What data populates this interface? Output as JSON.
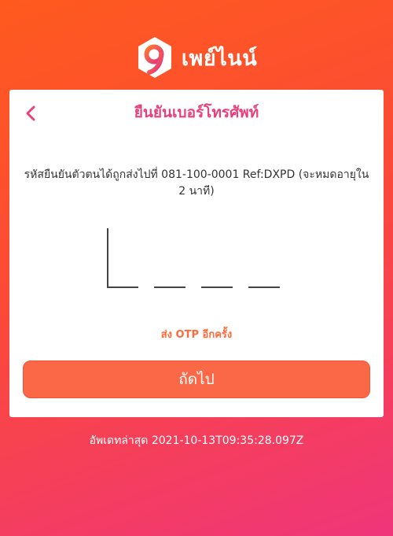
{
  "app": {
    "brand_name": "เพย์ไนน์",
    "logo_icon": "nine-hexagon-logo-icon"
  },
  "colors": {
    "gradient_top": "#ff5a1e",
    "gradient_bottom": "#f0357a",
    "accent_pink": "#e8407c",
    "accent_orange": "#fb6847"
  },
  "card": {
    "back_icon": "chevron-left-icon",
    "title": "ยืนยันเบอร์โทรศัพท์",
    "info_text": "รหัสยืนยันตัวตนได้ถูกส่งไปที่ 081-100-0001 Ref:DXPD (จะหมดอายุใน 2 นาที)",
    "otp": {
      "digits": [
        "",
        "",
        "",
        ""
      ]
    },
    "resend_label": "ส่ง OTP อีกครั้ง",
    "next_label": "ถัดไป"
  },
  "footer": {
    "last_updated": "อัพเดทล่าสุด 2021-10-13T09:35:28.097Z"
  }
}
